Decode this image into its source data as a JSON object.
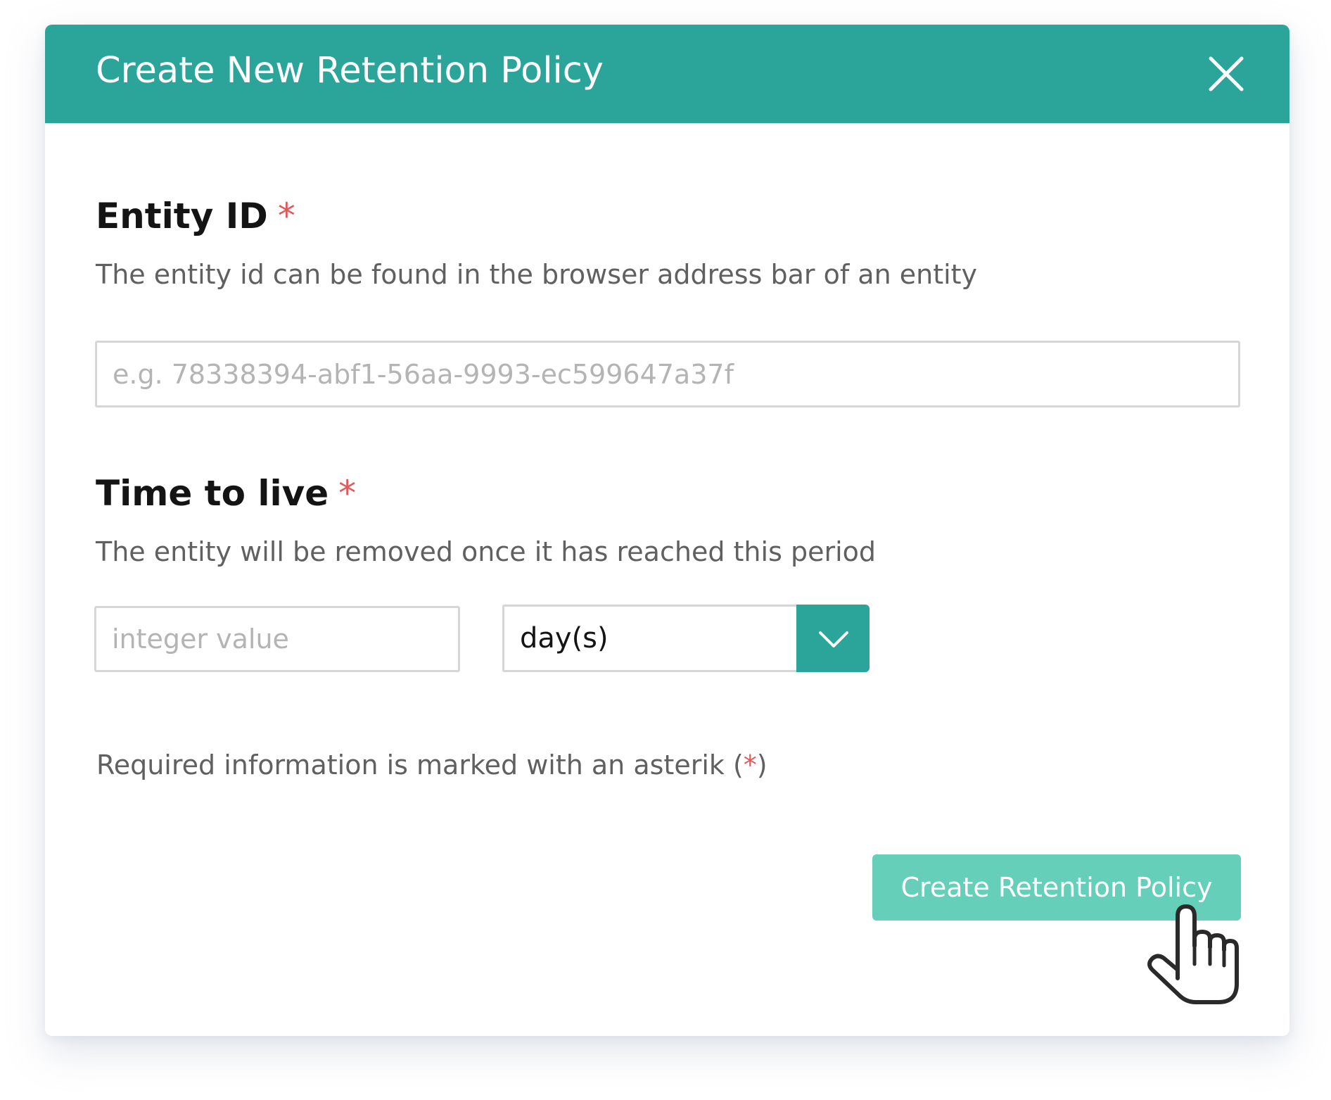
{
  "modal": {
    "title": "Create New Retention Policy"
  },
  "entity_id": {
    "label": "Entity ID",
    "required_mark": "*",
    "description": "The entity id can be found in the browser address bar of an entity",
    "placeholder": "e.g. 78338394-abf1-56aa-9993-ec599647a37f",
    "value": ""
  },
  "time_to_live": {
    "label": "Time to live",
    "required_mark": "*",
    "description": "The entity will be removed once it has reached this period",
    "value_placeholder": "integer value",
    "value": "",
    "unit_selected": "day(s)"
  },
  "note": {
    "text_before": "Required information is marked with an asterik (",
    "asterisk": "*",
    "text_after": ")"
  },
  "actions": {
    "submit_label": "Create Retention Policy"
  },
  "colors": {
    "header": "#2ba499",
    "submit": "#66cfb9",
    "required": "#e15a5a"
  },
  "icons": {
    "close": "close-icon",
    "dropdown": "chevron-down-icon",
    "cursor": "hand-pointer-icon"
  }
}
